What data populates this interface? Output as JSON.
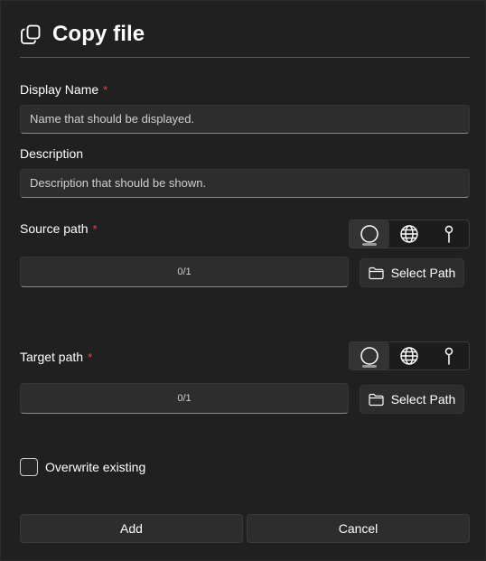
{
  "dialog": {
    "title": "Copy file",
    "icon": "copy-icon"
  },
  "display_name": {
    "label": "Display Name",
    "required_mark": "*",
    "placeholder": "Name that should be displayed."
  },
  "description": {
    "label": "Description",
    "placeholder": "Description that should be shown."
  },
  "source_path": {
    "label": "Source path",
    "required_mark": "*",
    "value": "0/1",
    "mode_options": [
      "circle-icon",
      "globe-icon",
      "pin-icon"
    ],
    "selected_mode": "circle-icon",
    "select_button": "Select Path",
    "select_icon": "folder-icon"
  },
  "target_path": {
    "label": "Target path",
    "required_mark": "*",
    "value": "0/1",
    "mode_options": [
      "circle-icon",
      "globe-icon",
      "pin-icon"
    ],
    "selected_mode": "circle-icon",
    "select_button": "Select Path",
    "select_icon": "folder-icon"
  },
  "overwrite": {
    "label": "Overwrite existing",
    "checked": false
  },
  "footer": {
    "add_label": "Add",
    "cancel_label": "Cancel"
  },
  "colors": {
    "background": "#202020",
    "field": "#2d2d2d",
    "required": "#e0464a",
    "text": "#ffffff"
  }
}
